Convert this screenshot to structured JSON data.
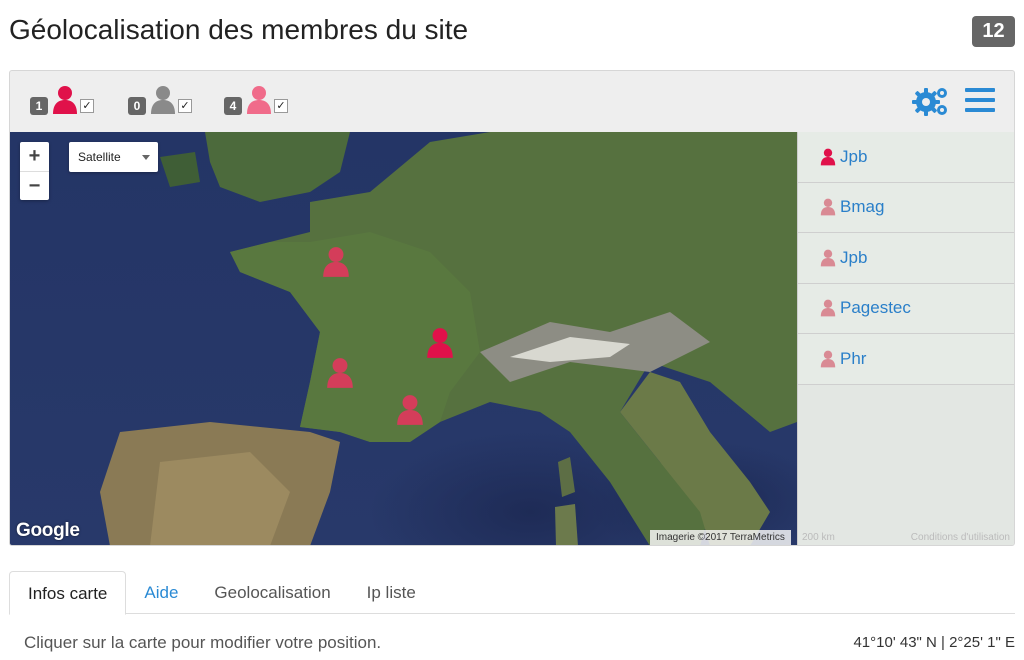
{
  "header": {
    "title": "Géolocalisation des membres du site",
    "count": "12"
  },
  "filters": [
    {
      "count": "1",
      "color": "#e0114a",
      "checked": "✓"
    },
    {
      "count": "0",
      "color": "#8a8a8a",
      "checked": "✓"
    },
    {
      "count": "4",
      "color": "#f06b8a",
      "checked": "✓"
    }
  ],
  "colors": {
    "accent": "#2a8ad4",
    "marker": "#e0114a",
    "marker_light": "#d98a94"
  },
  "map": {
    "zoom_in": "+",
    "zoom_out": "−",
    "map_type": "Satellite",
    "logo": "Google",
    "attribution": "Imagerie ©2017 TerraMetrics",
    "scale": "200 km",
    "terms": "Conditions d'utilisation"
  },
  "members": [
    {
      "name": "Jpb"
    },
    {
      "name": "Bmag"
    },
    {
      "name": "Jpb"
    },
    {
      "name": "Pagestec"
    },
    {
      "name": "Phr"
    }
  ],
  "tabs": [
    {
      "label": "Infos carte"
    },
    {
      "label": "Aide"
    },
    {
      "label": "Geolocalisation"
    },
    {
      "label": "Ip liste"
    }
  ],
  "footer": {
    "help": "Cliquer sur la carte pour modifier votre position.",
    "coords": "41°10' 43\" N | 2°25' 1\" E"
  }
}
